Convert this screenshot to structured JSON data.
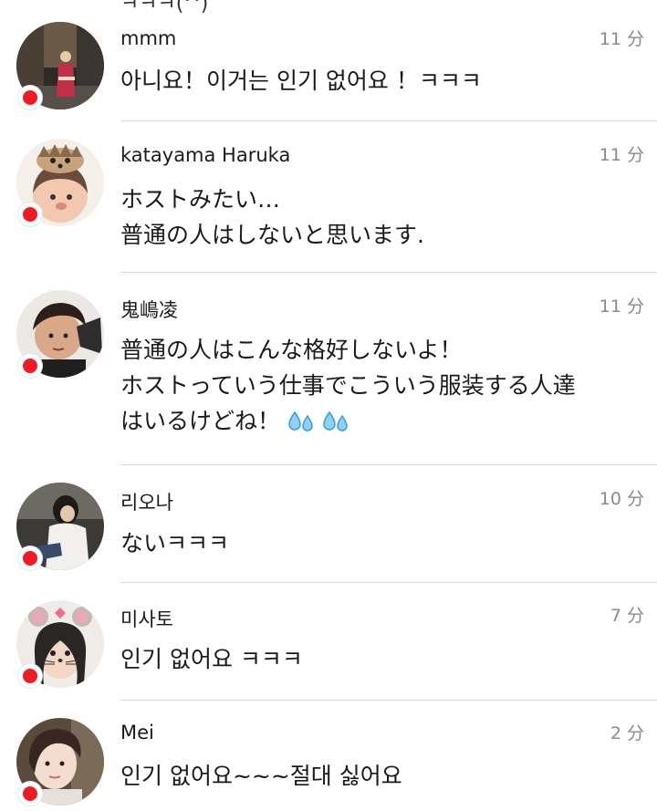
{
  "top_fragment": "ㅋㅋㅋ(^)",
  "comments": [
    {
      "username": "mmm",
      "time": "11 分",
      "text": "아니요！이거는 인기 없어요 ！ㅋㅋㅋ",
      "avatar_icon": "street-photo-avatar"
    },
    {
      "username": "katayama Haruka",
      "time": "11 分",
      "text": "ホストみたい…\n普通の人はしないと思います.",
      "avatar_icon": "hedgehog-filter-avatar"
    },
    {
      "username": "鬼嶋凌",
      "time": "11 分",
      "text": "普通の人はこんな格好しないよ！\nホストっていう仕事でこういう服装する人達\nはいるけどね！",
      "emoji": [
        "sweat-droplets-icon",
        "sweat-droplets-icon"
      ],
      "avatar_icon": "man-portrait-avatar"
    },
    {
      "username": "리오나",
      "time": "10 分",
      "text": "ないㅋㅋㅋ",
      "avatar_icon": "woman-sitting-avatar"
    },
    {
      "username": "미사토",
      "time": "7 分",
      "text": "인기 없어요 ㅋㅋㅋ",
      "avatar_icon": "mouse-ears-filter-avatar"
    },
    {
      "username": "Mei",
      "time": "2 分",
      "text": "인기 없어요~~~절대 싫어요",
      "avatar_icon": "woman-portrait-avatar"
    }
  ],
  "colors": {
    "badge_red": "#ee1b24",
    "time_gray": "#8a8a8a",
    "divider": "#d9d9d9"
  }
}
